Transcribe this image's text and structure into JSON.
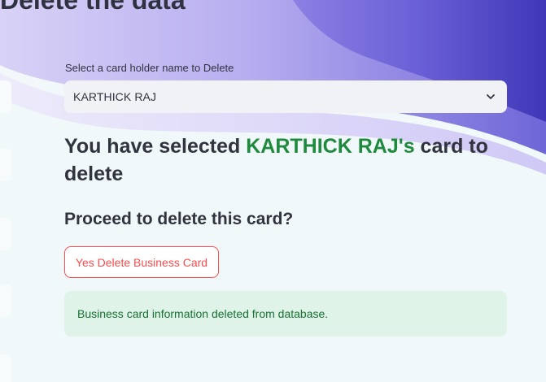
{
  "page": {
    "heading_partial": "Delete the data"
  },
  "select": {
    "label": "Select a card holder name to Delete",
    "value": "KARTHICK RAJ",
    "icon": "chevron-down-icon"
  },
  "selected_message": {
    "prefix": "You have selected ",
    "name": "KARTHICK RAJ's",
    "suffix": " card to delete",
    "highlight_color": "#1f8a3d"
  },
  "proceed": {
    "text": "Proceed to delete this card?"
  },
  "delete_button": {
    "label": "Yes Delete Business Card",
    "color": "#ff4b4b"
  },
  "alert": {
    "text": "Business card information deleted from database.",
    "background": "#dff3e8",
    "text_color": "#177233"
  }
}
